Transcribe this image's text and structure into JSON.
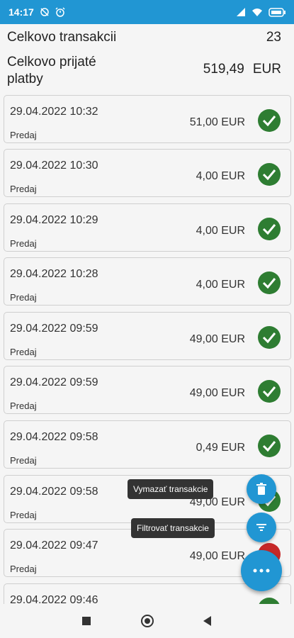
{
  "status_bar": {
    "time": "14:17",
    "left_icons": [
      "sync-off-icon",
      "alarm-icon"
    ],
    "right_icons": [
      "signal-icon",
      "wifi-icon",
      "battery-icon"
    ]
  },
  "summary": {
    "total_transactions_label": "Celkovo transakcii",
    "total_transactions_value": "23",
    "total_received_label": "Celkovo prijaté platby",
    "total_received_value": "519,49",
    "total_received_currency": "EUR"
  },
  "transactions": [
    {
      "datetime": "29.04.2022 10:32",
      "amount": "51,00 EUR",
      "type": "Predaj",
      "status": "success"
    },
    {
      "datetime": "29.04.2022 10:30",
      "amount": "4,00 EUR",
      "type": "Predaj",
      "status": "success"
    },
    {
      "datetime": "29.04.2022 10:29",
      "amount": "4,00 EUR",
      "type": "Predaj",
      "status": "success"
    },
    {
      "datetime": "29.04.2022 10:28",
      "amount": "4,00 EUR",
      "type": "Predaj",
      "status": "success"
    },
    {
      "datetime": "29.04.2022 09:59",
      "amount": "49,00 EUR",
      "type": "Predaj",
      "status": "success"
    },
    {
      "datetime": "29.04.2022 09:59",
      "amount": "49,00 EUR",
      "type": "Predaj",
      "status": "success"
    },
    {
      "datetime": "29.04.2022 09:58",
      "amount": "0,49 EUR",
      "type": "Predaj",
      "status": "success"
    },
    {
      "datetime": "29.04.2022 09:58",
      "amount": "49,00 EUR",
      "type": "Predaj",
      "status": "success"
    },
    {
      "datetime": "29.04.2022 09:47",
      "amount": "49,00 EUR",
      "type": "Predaj",
      "status": "error"
    },
    {
      "datetime": "29.04.2022 09:46",
      "amount": "",
      "type": "",
      "status": "success"
    }
  ],
  "fab_menu": {
    "delete_label": "Vymazať transakcie",
    "filter_label": "Filtrovať transakcie",
    "delete_icon": "trash-icon",
    "filter_icon": "filter-icon",
    "main_icon": "more-horiz-icon"
  },
  "colors": {
    "primary": "#2196d3",
    "success": "#2e7d32",
    "error": "#c62828"
  }
}
